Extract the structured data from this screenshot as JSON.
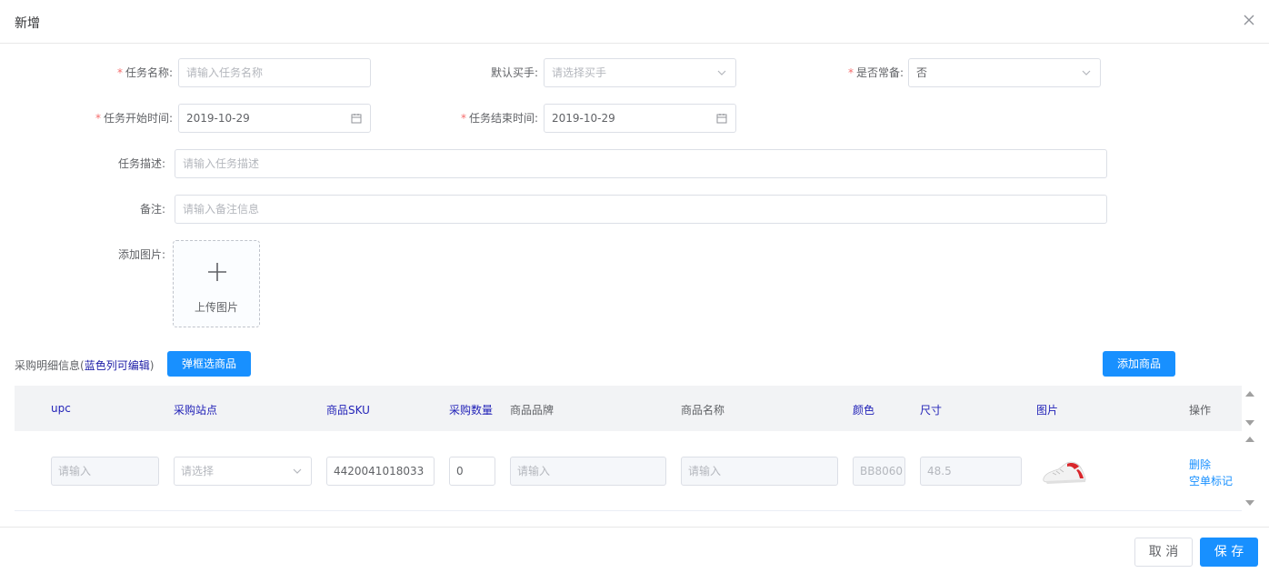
{
  "dialog": {
    "title": "新增"
  },
  "form": {
    "task_name": {
      "label": "任务名称:",
      "placeholder": "请输入任务名称"
    },
    "default_buyer": {
      "label": "默认买手:",
      "placeholder": "请选择买手"
    },
    "is_regular": {
      "label": "是否常备:",
      "value": "否"
    },
    "start_time": {
      "label": "任务开始时间:",
      "value": "2019-10-29"
    },
    "end_time": {
      "label": "任务结束时间:",
      "value": "2019-10-29"
    },
    "description": {
      "label": "任务描述:",
      "placeholder": "请输入任务描述"
    },
    "remark": {
      "label": "备注:",
      "placeholder": "请输入备注信息"
    },
    "add_image": {
      "label": "添加图片:",
      "upload_text": "上传图片"
    }
  },
  "purchase": {
    "section_prefix": "采购明细信息(",
    "section_highlight": "蓝色列可编辑",
    "section_suffix": ")",
    "popup_select_label": "弹框选商品",
    "add_product_label": "添加商品",
    "columns": [
      "upc",
      "采购站点",
      "商品SKU",
      "采购数量",
      "商品品牌",
      "商品名称",
      "颜色",
      "尺寸",
      "图片",
      "操作"
    ],
    "row": {
      "upc_placeholder": "请输入",
      "site_placeholder": "请选择",
      "sku": "4420041018033",
      "quantity": "0",
      "brand_placeholder": "请输入",
      "name_placeholder": "请输入",
      "color": "BB8060",
      "size": "48.5",
      "image_icon": "sneaker-image",
      "delete_label": "删除",
      "empty_mark_label": "空单标记"
    }
  },
  "footer": {
    "cancel_label": "取 消",
    "save_label": "保 存"
  },
  "colors": {
    "primary": "#1890ff",
    "required": "#f56c6c",
    "editable_column": "#2323b8"
  }
}
